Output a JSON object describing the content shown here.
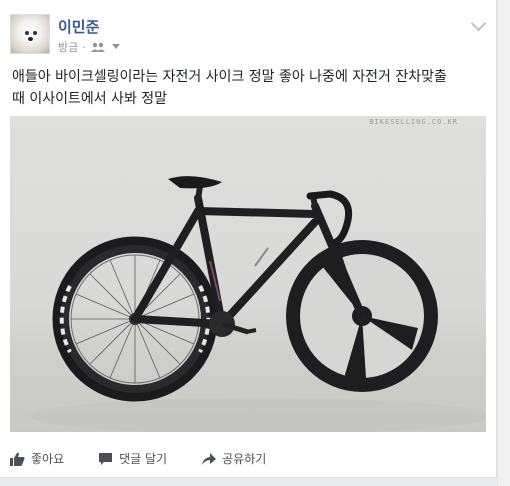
{
  "post": {
    "author": "이민준",
    "time": "방금",
    "privacy_icon": "friends-icon",
    "text_line1": "애들아 바이크셀링이라는 자전거 사이크 정말 좋아 나중에 자전거 잔차맞출",
    "text_line2": "때 이사이트에서 사봐 정말",
    "photo_watermark": "BIKESELLING.CO.KR"
  },
  "actions": {
    "like_label": "좋아요",
    "comment_label": "댓글 달기",
    "share_label": "공유하기"
  },
  "colors": {
    "link": "#365899",
    "meta": "#90949c",
    "text": "#1d2129"
  }
}
